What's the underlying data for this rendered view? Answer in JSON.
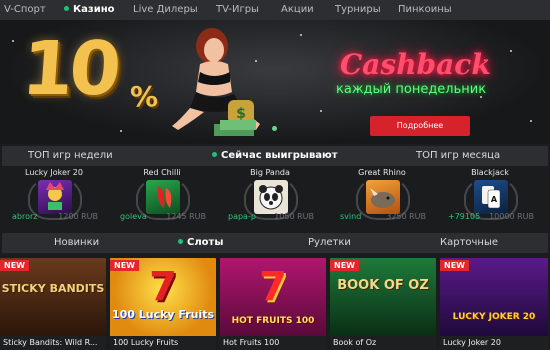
{
  "topnav": {
    "items": [
      {
        "label": "V-Спорт",
        "active": false
      },
      {
        "label": "Казино",
        "active": true
      },
      {
        "label": "Live Дилеры",
        "active": false
      },
      {
        "label": "TV-Игры",
        "active": false
      },
      {
        "label": "Акции",
        "active": false
      },
      {
        "label": "Турниры",
        "active": false
      },
      {
        "label": "Пинкоины",
        "active": false
      }
    ]
  },
  "banner": {
    "big_number": "10",
    "percent_sign": "%",
    "headline": "Cashback",
    "subheadline": "каждый понедельник",
    "button_label": "Подробнее",
    "colors": {
      "headline": "#ff4f6d",
      "subheadline": "#5cff7a",
      "button": "#d5222b",
      "number": "#f2c14e"
    }
  },
  "winners_header": {
    "left": "ТОП игр недели",
    "center": "Сейчас выигрывают",
    "right": "ТОП игр месяца"
  },
  "winners": [
    {
      "game": "Lucky Joker 20",
      "user": "abrorz",
      "amount": "1200 RUB"
    },
    {
      "game": "Red Chilli",
      "user": "goleva",
      "amount": "1245 RUB"
    },
    {
      "game": "Big Panda",
      "user": "papa-p",
      "amount": "1050 RUB"
    },
    {
      "game": "Great Rhino",
      "user": "svind",
      "amount": "3250 RUB"
    },
    {
      "game": "Blackjack",
      "user": "+79105",
      "amount": "10000 RUB"
    }
  ],
  "categories": {
    "items": [
      {
        "label": "Новинки",
        "active": false
      },
      {
        "label": "Слоты",
        "active": true
      },
      {
        "label": "Рулетки",
        "active": false
      },
      {
        "label": "Карточные",
        "active": false
      }
    ]
  },
  "games": [
    {
      "title": "Sticky Bandits: Wild R...",
      "badge": "NEW",
      "art_text": "STICKY BANDITS"
    },
    {
      "title": "100 Lucky Fruits",
      "badge": "NEW",
      "art_text": "100 Lucky Fruits"
    },
    {
      "title": "Hot Fruits 100",
      "badge": "",
      "art_text": "HOT FRUITS 100"
    },
    {
      "title": "Book of Oz",
      "badge": "NEW",
      "art_text": "BOOK OF OZ"
    },
    {
      "title": "Lucky Joker 20",
      "badge": "NEW",
      "art_text": "LUCKY JOKER 20"
    }
  ],
  "icons": {
    "active_dot": "green-dot-icon",
    "new_badge": "new-badge-icon"
  }
}
